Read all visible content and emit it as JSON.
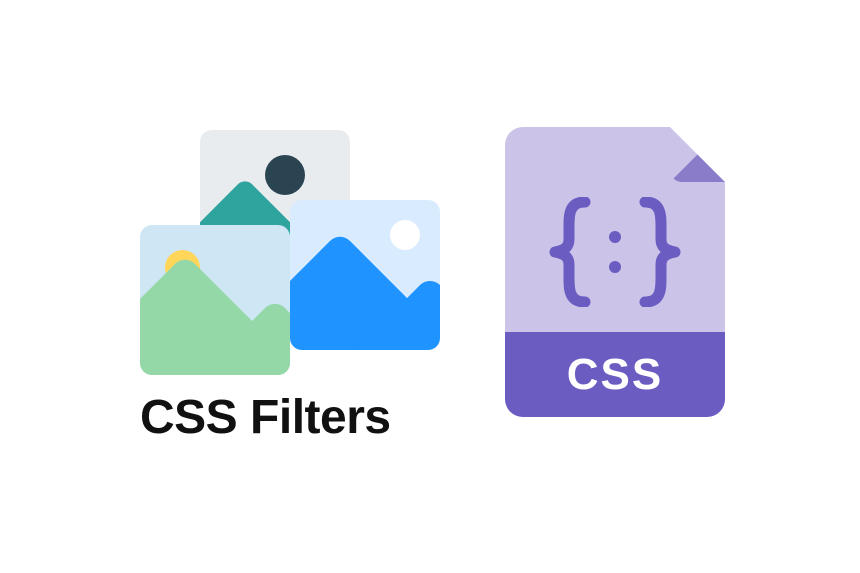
{
  "caption": "CSS Filters",
  "file": {
    "label": "CSS",
    "brace_open": "{",
    "brace_close": "}"
  }
}
